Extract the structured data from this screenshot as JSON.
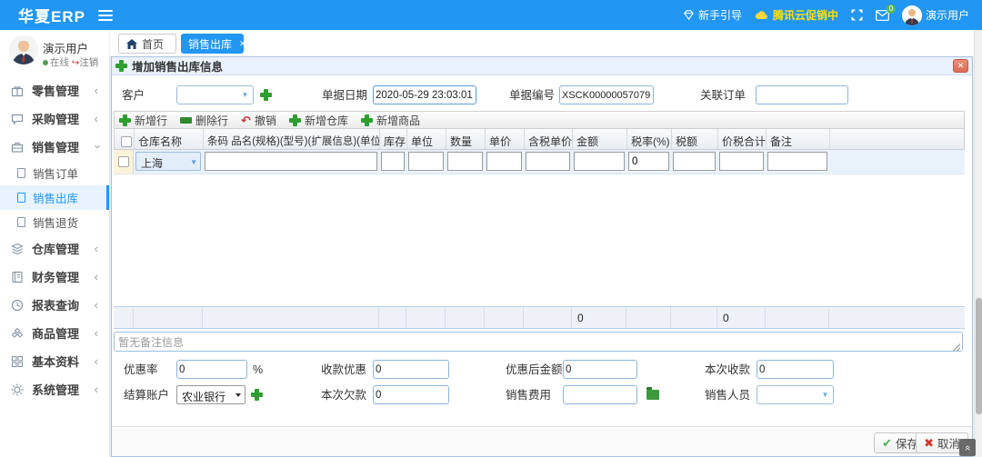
{
  "colors": {
    "accent": "#2196f3",
    "promo_yellow": "#ffe100",
    "green": "#34a134",
    "red": "#d9534f"
  },
  "topbar": {
    "logo": "华夏ERP",
    "guide": "新手引导",
    "promo": "腾讯云促销中",
    "mail_badge": "0",
    "user": "演示用户"
  },
  "sidebar": {
    "user": {
      "name": "演示用户",
      "online": "在线",
      "logout": "注销"
    },
    "items": [
      {
        "label": "零售管理"
      },
      {
        "label": "采购管理"
      },
      {
        "label": "销售管理"
      },
      {
        "label": "仓库管理"
      },
      {
        "label": "财务管理"
      },
      {
        "label": "报表查询"
      },
      {
        "label": "商品管理"
      },
      {
        "label": "基本资料"
      },
      {
        "label": "系统管理"
      }
    ],
    "sales_children": [
      {
        "label": "销售订单"
      },
      {
        "label": "销售出库"
      },
      {
        "label": "销售退货"
      }
    ]
  },
  "tabs": {
    "home": "首页",
    "current": "销售出库"
  },
  "modal": {
    "title": "增加销售出库信息",
    "fields": {
      "customer_label": "客户",
      "date_label": "单据日期",
      "date_value": "2020-05-29 23:03:01",
      "number_label": "单据编号",
      "number_value": "XSCK00000057079",
      "linked_label": "关联订单",
      "linked_value": ""
    },
    "toolbar": {
      "add_row": "新增行",
      "delete_row": "删除行",
      "undo": "撤销",
      "add_warehouse": "新增仓库",
      "add_product": "新增商品"
    },
    "grid": {
      "columns": [
        "仓库名称",
        "条码 品名(规格)(型号)(扩展信息)(单位)",
        "库存",
        "单位",
        "数量",
        "单价",
        "含税单价",
        "金额",
        "税率(%)",
        "税额",
        "价税合计",
        "备注"
      ],
      "row": {
        "warehouse": "上海",
        "tax_rate": "0"
      },
      "totals": {
        "amount": "0",
        "total": "0"
      }
    },
    "remark_placeholder": "暂无备注信息",
    "settle": {
      "discount_label": "优惠率",
      "discount_value": "0",
      "discount_suffix": "%",
      "collect_discount_label": "收款优惠",
      "collect_discount_value": "0",
      "after_discount_label": "优惠后金额",
      "after_discount_value": "0",
      "received_label": "本次收款",
      "received_value": "0",
      "account_label": "结算账户",
      "account_value": "农业银行",
      "debt_label": "本次欠款",
      "debt_value": "0",
      "fee_label": "销售费用",
      "fee_value": "",
      "salesman_label": "销售人员",
      "salesman_value": ""
    },
    "buttons": {
      "save": "保存",
      "cancel": "取消"
    }
  }
}
